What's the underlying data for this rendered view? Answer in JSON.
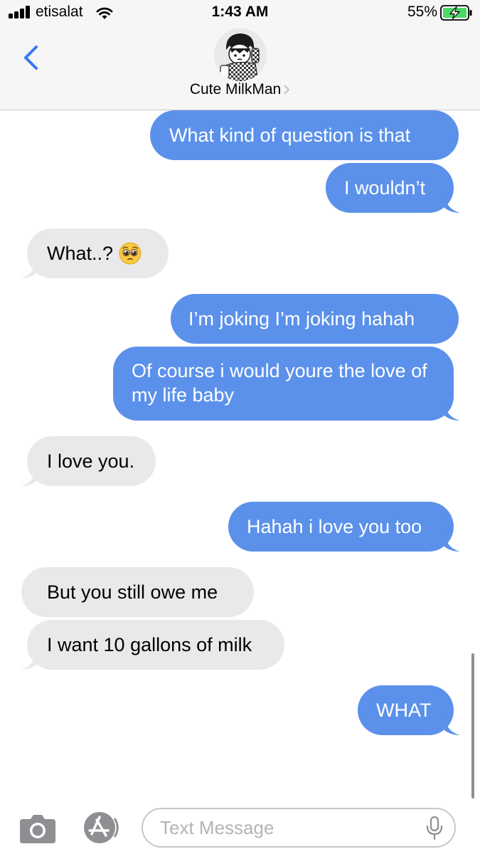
{
  "status_bar": {
    "carrier": "etisalat",
    "time": "1:43 AM",
    "battery": "55%"
  },
  "header": {
    "contact_name": "Cute MilkMan",
    "back_icon": "chevron-left-icon"
  },
  "messages": [
    {
      "direction": "sent",
      "text": "What kind of question is that",
      "tail": false
    },
    {
      "direction": "sent",
      "text": "I wouldn’t",
      "tail": true
    },
    {
      "direction": "received",
      "text": "What..?",
      "emoji": "pleading-face",
      "tail": true
    },
    {
      "direction": "sent",
      "text": "I’m joking I’m joking hahah",
      "tail": false
    },
    {
      "direction": "sent",
      "text": "Of course i would youre the love of my life baby",
      "tail": true
    },
    {
      "direction": "received",
      "text": "I love you.",
      "tail": true
    },
    {
      "direction": "sent",
      "text": "Hahah i love you too",
      "tail": true
    },
    {
      "direction": "received",
      "text": "But you still owe me",
      "tail": false
    },
    {
      "direction": "received",
      "text": "I want 10 gallons of milk",
      "tail": true
    },
    {
      "direction": "sent",
      "text": "WHAT",
      "tail": true
    }
  ],
  "input_bar": {
    "placeholder": "Text Message",
    "value": "",
    "icons": [
      "camera-icon",
      "app-store-icon",
      "microphone-icon"
    ]
  },
  "colors": {
    "sent_bubble": "#5b91ea",
    "received_bubble": "#e9e9eb",
    "accent": "#3478f6",
    "bar_background": "#f6f6f6"
  }
}
